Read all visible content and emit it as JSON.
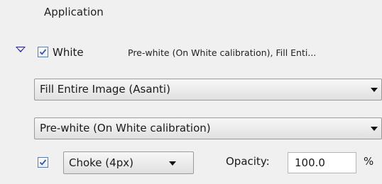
{
  "section": {
    "title": "Application"
  },
  "white_row": {
    "checked": true,
    "label": "White",
    "summary": "Pre-white (On White calibration), Fill Enti..."
  },
  "fill_dropdown": {
    "selected": "Fill Entire Image (Asanti)"
  },
  "prewhite_dropdown": {
    "selected": "Pre-white (On White calibration)"
  },
  "choke_row": {
    "checked": true,
    "choke_selected": "Choke (4px)",
    "opacity_label": "Opacity:",
    "opacity_value": "100.0",
    "unit": "%"
  },
  "colors": {
    "check": "#2a5aa8",
    "disclosure": "#1a1a8c"
  }
}
